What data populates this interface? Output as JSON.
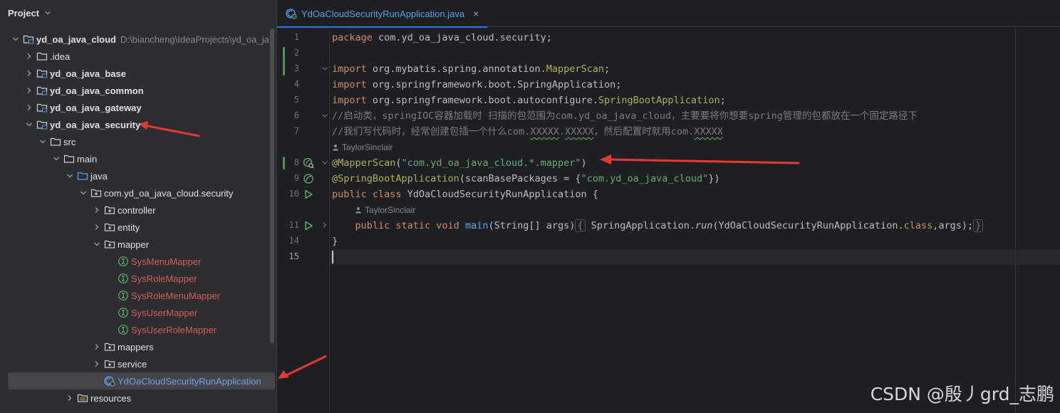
{
  "panel": {
    "title": "Project"
  },
  "tree": [
    {
      "label": "yd_oa_java_cloud",
      "path": "D:\\biancheng\\IdeaProjects\\yd_oa_ja",
      "bold": true,
      "indent": 0,
      "expanded": true,
      "icon": "module-folder-icon"
    },
    {
      "label": ".idea",
      "indent": 1,
      "expanded": false,
      "icon": "folder-icon"
    },
    {
      "label": "yd_oa_java_base",
      "bold": true,
      "indent": 1,
      "expanded": false,
      "icon": "module-folder-icon"
    },
    {
      "label": "yd_oa_java_common",
      "bold": true,
      "indent": 1,
      "expanded": false,
      "icon": "module-folder-icon"
    },
    {
      "label": "yd_oa_java_gateway",
      "bold": true,
      "indent": 1,
      "expanded": false,
      "icon": "module-folder-icon"
    },
    {
      "label": "yd_oa_java_security",
      "bold": true,
      "indent": 1,
      "expanded": true,
      "icon": "module-folder-icon"
    },
    {
      "label": "src",
      "indent": 2,
      "expanded": true,
      "icon": "folder-icon"
    },
    {
      "label": "main",
      "indent": 3,
      "expanded": true,
      "icon": "folder-icon"
    },
    {
      "label": "java",
      "indent": 4,
      "expanded": true,
      "icon": "source-folder-icon"
    },
    {
      "label": "com.yd_oa_java_cloud.security",
      "indent": 5,
      "expanded": true,
      "icon": "package-icon"
    },
    {
      "label": "controller",
      "indent": 6,
      "expanded": false,
      "icon": "package-icon"
    },
    {
      "label": "entity",
      "indent": 6,
      "expanded": false,
      "icon": "package-icon"
    },
    {
      "label": "mapper",
      "indent": 6,
      "expanded": true,
      "icon": "package-icon"
    },
    {
      "label": "SysMenuMapper",
      "indent": 7,
      "leaf": true,
      "color": "red",
      "icon": "interface-icon"
    },
    {
      "label": "SysRoleMapper",
      "indent": 7,
      "leaf": true,
      "color": "red",
      "icon": "interface-icon"
    },
    {
      "label": "SysRoleMenuMapper",
      "indent": 7,
      "leaf": true,
      "color": "red",
      "icon": "interface-icon"
    },
    {
      "label": "SysUserMapper",
      "indent": 7,
      "leaf": true,
      "color": "red",
      "icon": "interface-icon"
    },
    {
      "label": "SysUserRoleMapper",
      "indent": 7,
      "leaf": true,
      "color": "red",
      "icon": "interface-icon"
    },
    {
      "label": "mappers",
      "indent": 6,
      "expanded": false,
      "icon": "package-icon"
    },
    {
      "label": "service",
      "indent": 6,
      "expanded": false,
      "icon": "package-icon"
    },
    {
      "label": "YdOaCloudSecurityRunApplication",
      "indent": 6,
      "leaf": true,
      "color": "blue",
      "selected": true,
      "icon": "spring-class-icon"
    },
    {
      "label": "resources",
      "indent": 4,
      "expanded": false,
      "icon": "resources-folder-icon"
    }
  ],
  "editor": {
    "tab": {
      "label": "YdOaCloudSecurityRunApplication.java",
      "close": "×"
    },
    "author_hint": "TaylorSinclair",
    "lines": [
      {
        "n": "1",
        "tokens": [
          [
            "kw",
            "package "
          ],
          [
            "",
            "com.yd_oa_java_cloud.security;"
          ]
        ]
      },
      {
        "n": "2",
        "tokens": []
      },
      {
        "n": "3",
        "fold": true,
        "tokens": [
          [
            "kw",
            "import "
          ],
          [
            "",
            "org.mybatis.spring.annotation."
          ],
          [
            "ann",
            "MapperScan"
          ],
          [
            "",
            ";"
          ]
        ]
      },
      {
        "n": "4",
        "tokens": [
          [
            "kw",
            "import "
          ],
          [
            "",
            "org.springframework.boot.SpringApplication;"
          ]
        ]
      },
      {
        "n": "5",
        "tokens": [
          [
            "kw",
            "import "
          ],
          [
            "",
            "org.springframework.boot.autoconfigure."
          ],
          [
            "ann",
            "SpringBootApplication"
          ],
          [
            "",
            ";"
          ]
        ]
      },
      {
        "n": "6",
        "fold": true,
        "tokens": [
          [
            "cmt",
            "//启动类，springIOC容器加载时 扫描的包范围为com.yd_oa_java_cloud，主要要将你想要spring管理的包都放在一个固定路径下"
          ]
        ]
      },
      {
        "n": "7",
        "tokens": [
          [
            "cmt",
            "//我们写代码时，经常创建包插一个什么com."
          ],
          [
            "cmt squig",
            "XXXXX"
          ],
          [
            "cmt",
            "."
          ],
          [
            "cmt squig",
            "XXXXX"
          ],
          [
            "cmt",
            "，然后配置时就用com."
          ],
          [
            "cmt squig",
            "XXXXX"
          ]
        ]
      },
      {
        "n": "8",
        "fold": true,
        "icon": "bean-search",
        "tokens": [
          [
            "ann",
            "@MapperScan"
          ],
          [
            "",
            "("
          ],
          [
            "str",
            "\"com.yd_oa_java_cloud.*.mapper\""
          ],
          [
            "",
            ")"
          ]
        ]
      },
      {
        "n": "9",
        "icon": "bean",
        "tokens": [
          [
            "ann",
            "@SpringBootApplication"
          ],
          [
            "",
            "(scanBasePackages = {"
          ],
          [
            "str",
            "\"com.yd_oa_java_cloud\""
          ],
          [
            "",
            "})"
          ]
        ]
      },
      {
        "n": "10",
        "icon": "run",
        "tokens": [
          [
            "kw",
            "public class "
          ],
          [
            "",
            "YdOaCloudSecurityRunApplication {"
          ]
        ]
      },
      {
        "n": "11",
        "fold": true,
        "icon": "run",
        "tokens": [
          [
            "",
            "    "
          ],
          [
            "kw",
            "public static void "
          ],
          [
            "fn",
            "main"
          ],
          [
            "",
            "(String[] args)"
          ],
          [
            "fold-box",
            "{"
          ],
          [
            "",
            " SpringApplication."
          ],
          [
            "it",
            "run"
          ],
          [
            "",
            "(YdOaCloudSecurityRunApplication."
          ],
          [
            "kw",
            "class"
          ],
          [
            "",
            ",args);"
          ],
          [
            "fold-box",
            "}"
          ]
        ]
      },
      {
        "n": "14",
        "tokens": [
          [
            "",
            "}"
          ]
        ]
      },
      {
        "n": "15",
        "current": true,
        "tokens": []
      }
    ]
  },
  "watermark": "CSDN @殷丿grd_志鹏",
  "colors": {
    "arrow": "#e53935",
    "accent": "#3574f0",
    "vcs": "#549159"
  }
}
